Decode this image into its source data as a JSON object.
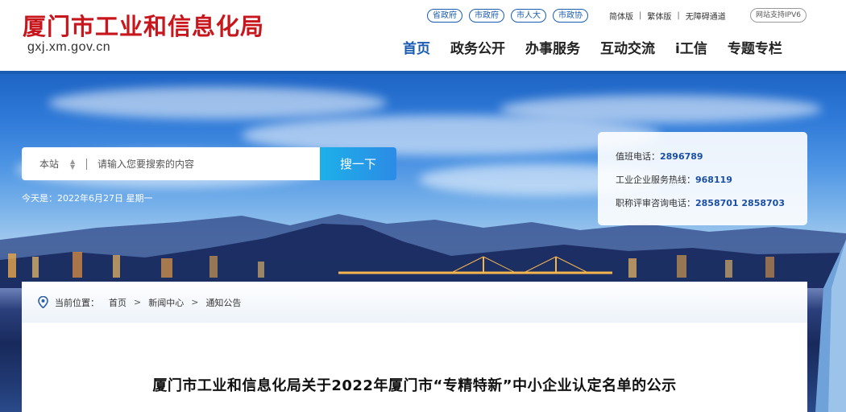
{
  "site": {
    "title": "厦门市工业和信息化局",
    "domain": "gxj.xm.gov.cn"
  },
  "header": {
    "gov_links": [
      "省政府",
      "市政府",
      "市人大",
      "市政协"
    ],
    "util_links": [
      "简体版",
      "繁体版",
      "无障碍通道"
    ],
    "ipv6_badge": "网站支持IPV6"
  },
  "nav": {
    "items": [
      "首页",
      "政务公开",
      "办事服务",
      "互动交流",
      "i工信",
      "专题专栏"
    ],
    "active": "首页"
  },
  "search": {
    "scope": "本站",
    "placeholder": "请输入您要搜索的内容",
    "button_label": "搜一下"
  },
  "date_text": "今天是：2022年6月27日 星期一",
  "contact": {
    "duty_label": "值班电话：",
    "duty_number": "2896789",
    "hotline_label": "工业企业服务热线：",
    "hotline_number": "968119",
    "title_eval_label": "职称评审咨询电话：",
    "title_eval_numbers": "2858701 2858703"
  },
  "breadcrumb": {
    "label": "当前位置：",
    "items": [
      "首页",
      "新闻中心",
      "通知公告"
    ]
  },
  "article": {
    "title": "厦门市工业和信息化局关于2022年厦门市“专精特新”中小企业认定名单的公示"
  },
  "colors": {
    "brand_red": "#c8161d",
    "brand_blue": "#1a5cb0",
    "search_button": "#1db0e8"
  }
}
